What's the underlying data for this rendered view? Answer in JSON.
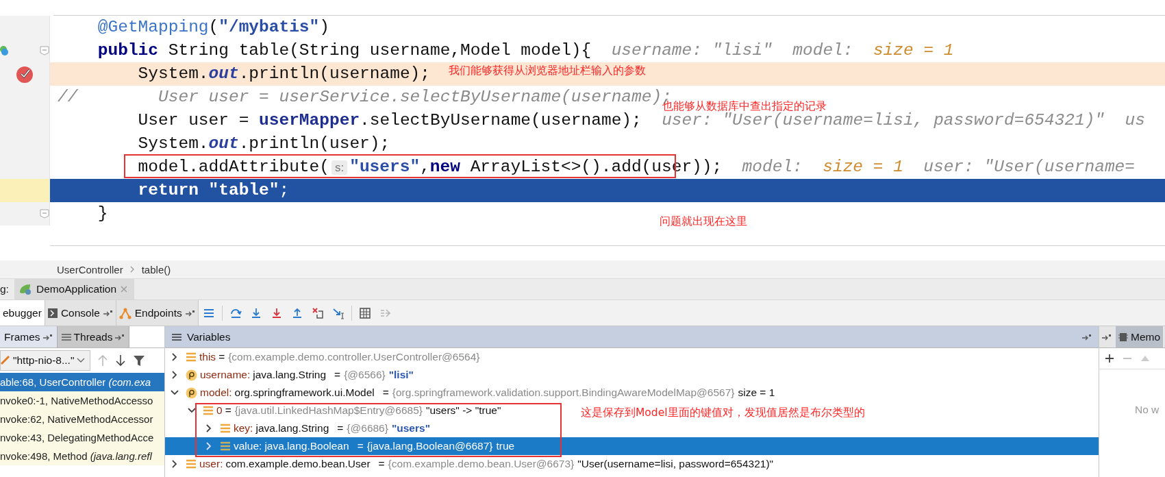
{
  "editor": {
    "lines": [
      {
        "segments": [
          {
            "kind": "annotation",
            "text": "    @GetMapping"
          },
          {
            "kind": "plain",
            "text": "("
          },
          {
            "kind": "string",
            "text": "\"/mybatis\""
          },
          {
            "kind": "plain",
            "text": ")"
          }
        ],
        "breakpoint": false,
        "current": false,
        "foldable": false,
        "bean": false
      },
      {
        "segments": [
          {
            "kind": "keyword",
            "text": "    public"
          },
          {
            "kind": "plain",
            "text": " String table(String username,Model model){"
          },
          {
            "kind": "hint",
            "text": "  username: \"lisi\"  model:  "
          },
          {
            "kind": "hint_value",
            "text": "size = 1"
          }
        ],
        "breakpoint": false,
        "current": false,
        "foldable": true,
        "bean": true
      },
      {
        "segments": [
          {
            "kind": "plain",
            "text": "        System."
          },
          {
            "kind": "static",
            "text": "out"
          },
          {
            "kind": "plain",
            "text": ".println(username);"
          }
        ],
        "breakpoint": true,
        "current": false,
        "foldable": false,
        "bean": false
      },
      {
        "segments": [
          {
            "kind": "comment",
            "text": "//        User user = userService.selectByUsername(username);"
          }
        ],
        "breakpoint": false,
        "current": false,
        "foldable": false,
        "bean": false
      },
      {
        "segments": [
          {
            "kind": "plain",
            "text": "        User user = "
          },
          {
            "kind": "field",
            "text": "userMapper"
          },
          {
            "kind": "plain",
            "text": ".selectByUsername(username);"
          },
          {
            "kind": "hint",
            "text": "  user: \"User(username=lisi, password=654321)\"  us"
          }
        ],
        "breakpoint": false,
        "current": false,
        "foldable": false,
        "bean": false
      },
      {
        "segments": [
          {
            "kind": "plain",
            "text": "        System."
          },
          {
            "kind": "static",
            "text": "out"
          },
          {
            "kind": "plain",
            "text": ".println(user);"
          }
        ],
        "breakpoint": false,
        "current": false,
        "foldable": false,
        "bean": false
      },
      {
        "segments": [
          {
            "kind": "plain",
            "text": "        model.addAttribute("
          },
          {
            "kind": "param_hint",
            "text": "s:"
          },
          {
            "kind": "string",
            "text": "\"users\""
          },
          {
            "kind": "plain",
            "text": ","
          },
          {
            "kind": "keyword",
            "text": "new"
          },
          {
            "kind": "plain",
            "text": " ArrayList<>().add(user));"
          },
          {
            "kind": "hint",
            "text": "  model:  "
          },
          {
            "kind": "hint_value",
            "text": "size = 1"
          },
          {
            "kind": "hint",
            "text": "  user: \"User(username="
          }
        ],
        "breakpoint": false,
        "current": false,
        "foldable": false,
        "bean": false
      },
      {
        "segments": [
          {
            "kind": "keyword",
            "text": "        return"
          },
          {
            "kind": "string",
            "text": " \"table\""
          },
          {
            "kind": "plain",
            "text": ";"
          }
        ],
        "breakpoint": false,
        "current": true,
        "foldable": false,
        "bean": false
      },
      {
        "segments": [
          {
            "kind": "plain",
            "text": "    }"
          }
        ],
        "breakpoint": false,
        "current": false,
        "foldable": true,
        "bean": false
      }
    ]
  },
  "annotations": [
    {
      "text": "我们能够获得从浏览器地址栏输入的参数"
    },
    {
      "text": "也能够从数据库中查出指定的记录"
    },
    {
      "text": "问题就出现在这里"
    },
    {
      "text": "这是保存到Model里面的键值对，发现值居然是布尔类型的"
    }
  ],
  "breadcrumb": [
    "UserController",
    "table()"
  ],
  "debug_bar": {
    "label": "g:",
    "session_tab": "DemoApplication"
  },
  "tool_tabs": [
    {
      "label": "ebugger",
      "selected": true
    },
    {
      "label": "Console",
      "selected": false
    },
    {
      "label": "Endpoints",
      "selected": false
    }
  ],
  "frames_panel": {
    "tabs": [
      {
        "label": "Frames",
        "selected": true
      },
      {
        "label": "Threads",
        "selected": false
      }
    ],
    "thread": "\"http-nio-8...\"",
    "frames": [
      {
        "text": "able:68, UserController ",
        "detail": "(com.exa",
        "selected": true,
        "library": false
      },
      {
        "text": "nvoke0:-1, NativeMethodAccesso",
        "selected": false,
        "library": true
      },
      {
        "text": "nvoke:62, NativeMethodAccessor",
        "selected": false,
        "library": true
      },
      {
        "text": "nvoke:43, DelegatingMethodAcce",
        "selected": false,
        "library": true
      },
      {
        "text": "nvoke:498, Method ",
        "detail": "(java.lang.refl",
        "selected": false,
        "library": true
      }
    ]
  },
  "variables_panel": {
    "title": "Variables",
    "variables": [
      {
        "kind": "field",
        "label": "this",
        "op": "=",
        "ref": "{com.example.demo.controller.UserController@6564}",
        "expanded": false,
        "selected": false
      },
      {
        "kind": "param",
        "label": "username:",
        "type": "java.lang.String",
        "op": "=",
        "ref": "{@6566}",
        "value": "\"lisi\"",
        "string_value": true,
        "expanded": false,
        "selected": false
      },
      {
        "kind": "param",
        "label": "model:",
        "type": "org.springframework.ui.Model",
        "op": "=",
        "ref": "{org.springframework.validation.support.BindingAwareModelMap@6567}",
        "value": "size = 1",
        "string_value": false,
        "expanded": true,
        "selected": false,
        "children": [
          {
            "kind": "field",
            "label": "0",
            "op": "=",
            "ref": "{java.util.LinkedHashMap$Entry@6685}",
            "value": "\"users\" -> \"true\"",
            "string_value": false,
            "expanded": true,
            "selected": false,
            "children": [
              {
                "kind": "field",
                "label": "key:",
                "type": "java.lang.String",
                "op": "=",
                "ref": "{@6686}",
                "value": "\"users\"",
                "string_value": true,
                "expanded": false,
                "selected": false
              },
              {
                "kind": "field",
                "label": "value:",
                "type": "java.lang.Boolean",
                "op": "=",
                "ref": "{java.lang.Boolean@6687}",
                "value": "true",
                "string_value": false,
                "expanded": false,
                "selected": true
              }
            ]
          }
        ]
      },
      {
        "kind": "field",
        "label": "user:",
        "type": "com.example.demo.bean.User",
        "op": "=",
        "ref": "{com.example.demo.bean.User@6673}",
        "value": "\"User(username=lisi, password=654321)\"",
        "string_value": false,
        "expanded": false,
        "selected": false
      }
    ]
  },
  "memory_panel": {
    "tab": "Memo",
    "message": "No w"
  }
}
